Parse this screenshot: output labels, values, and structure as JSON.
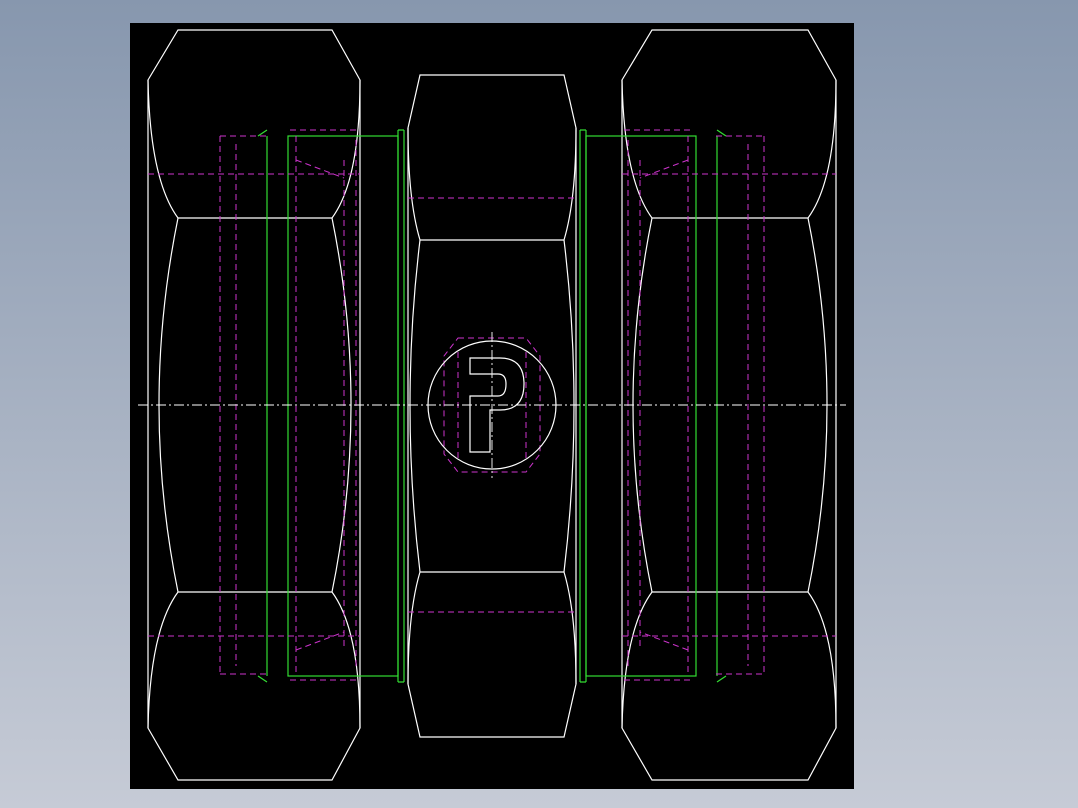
{
  "colors": {
    "background_top": "#8797ae",
    "background_bottom": "#c6cbd6",
    "viewport": "#000000",
    "outline": "#ffffff",
    "green": "#33dd33",
    "hidden": "#cc33cc",
    "center": "#ffffff"
  },
  "icons": {
    "logo": "parker-p-logo"
  }
}
